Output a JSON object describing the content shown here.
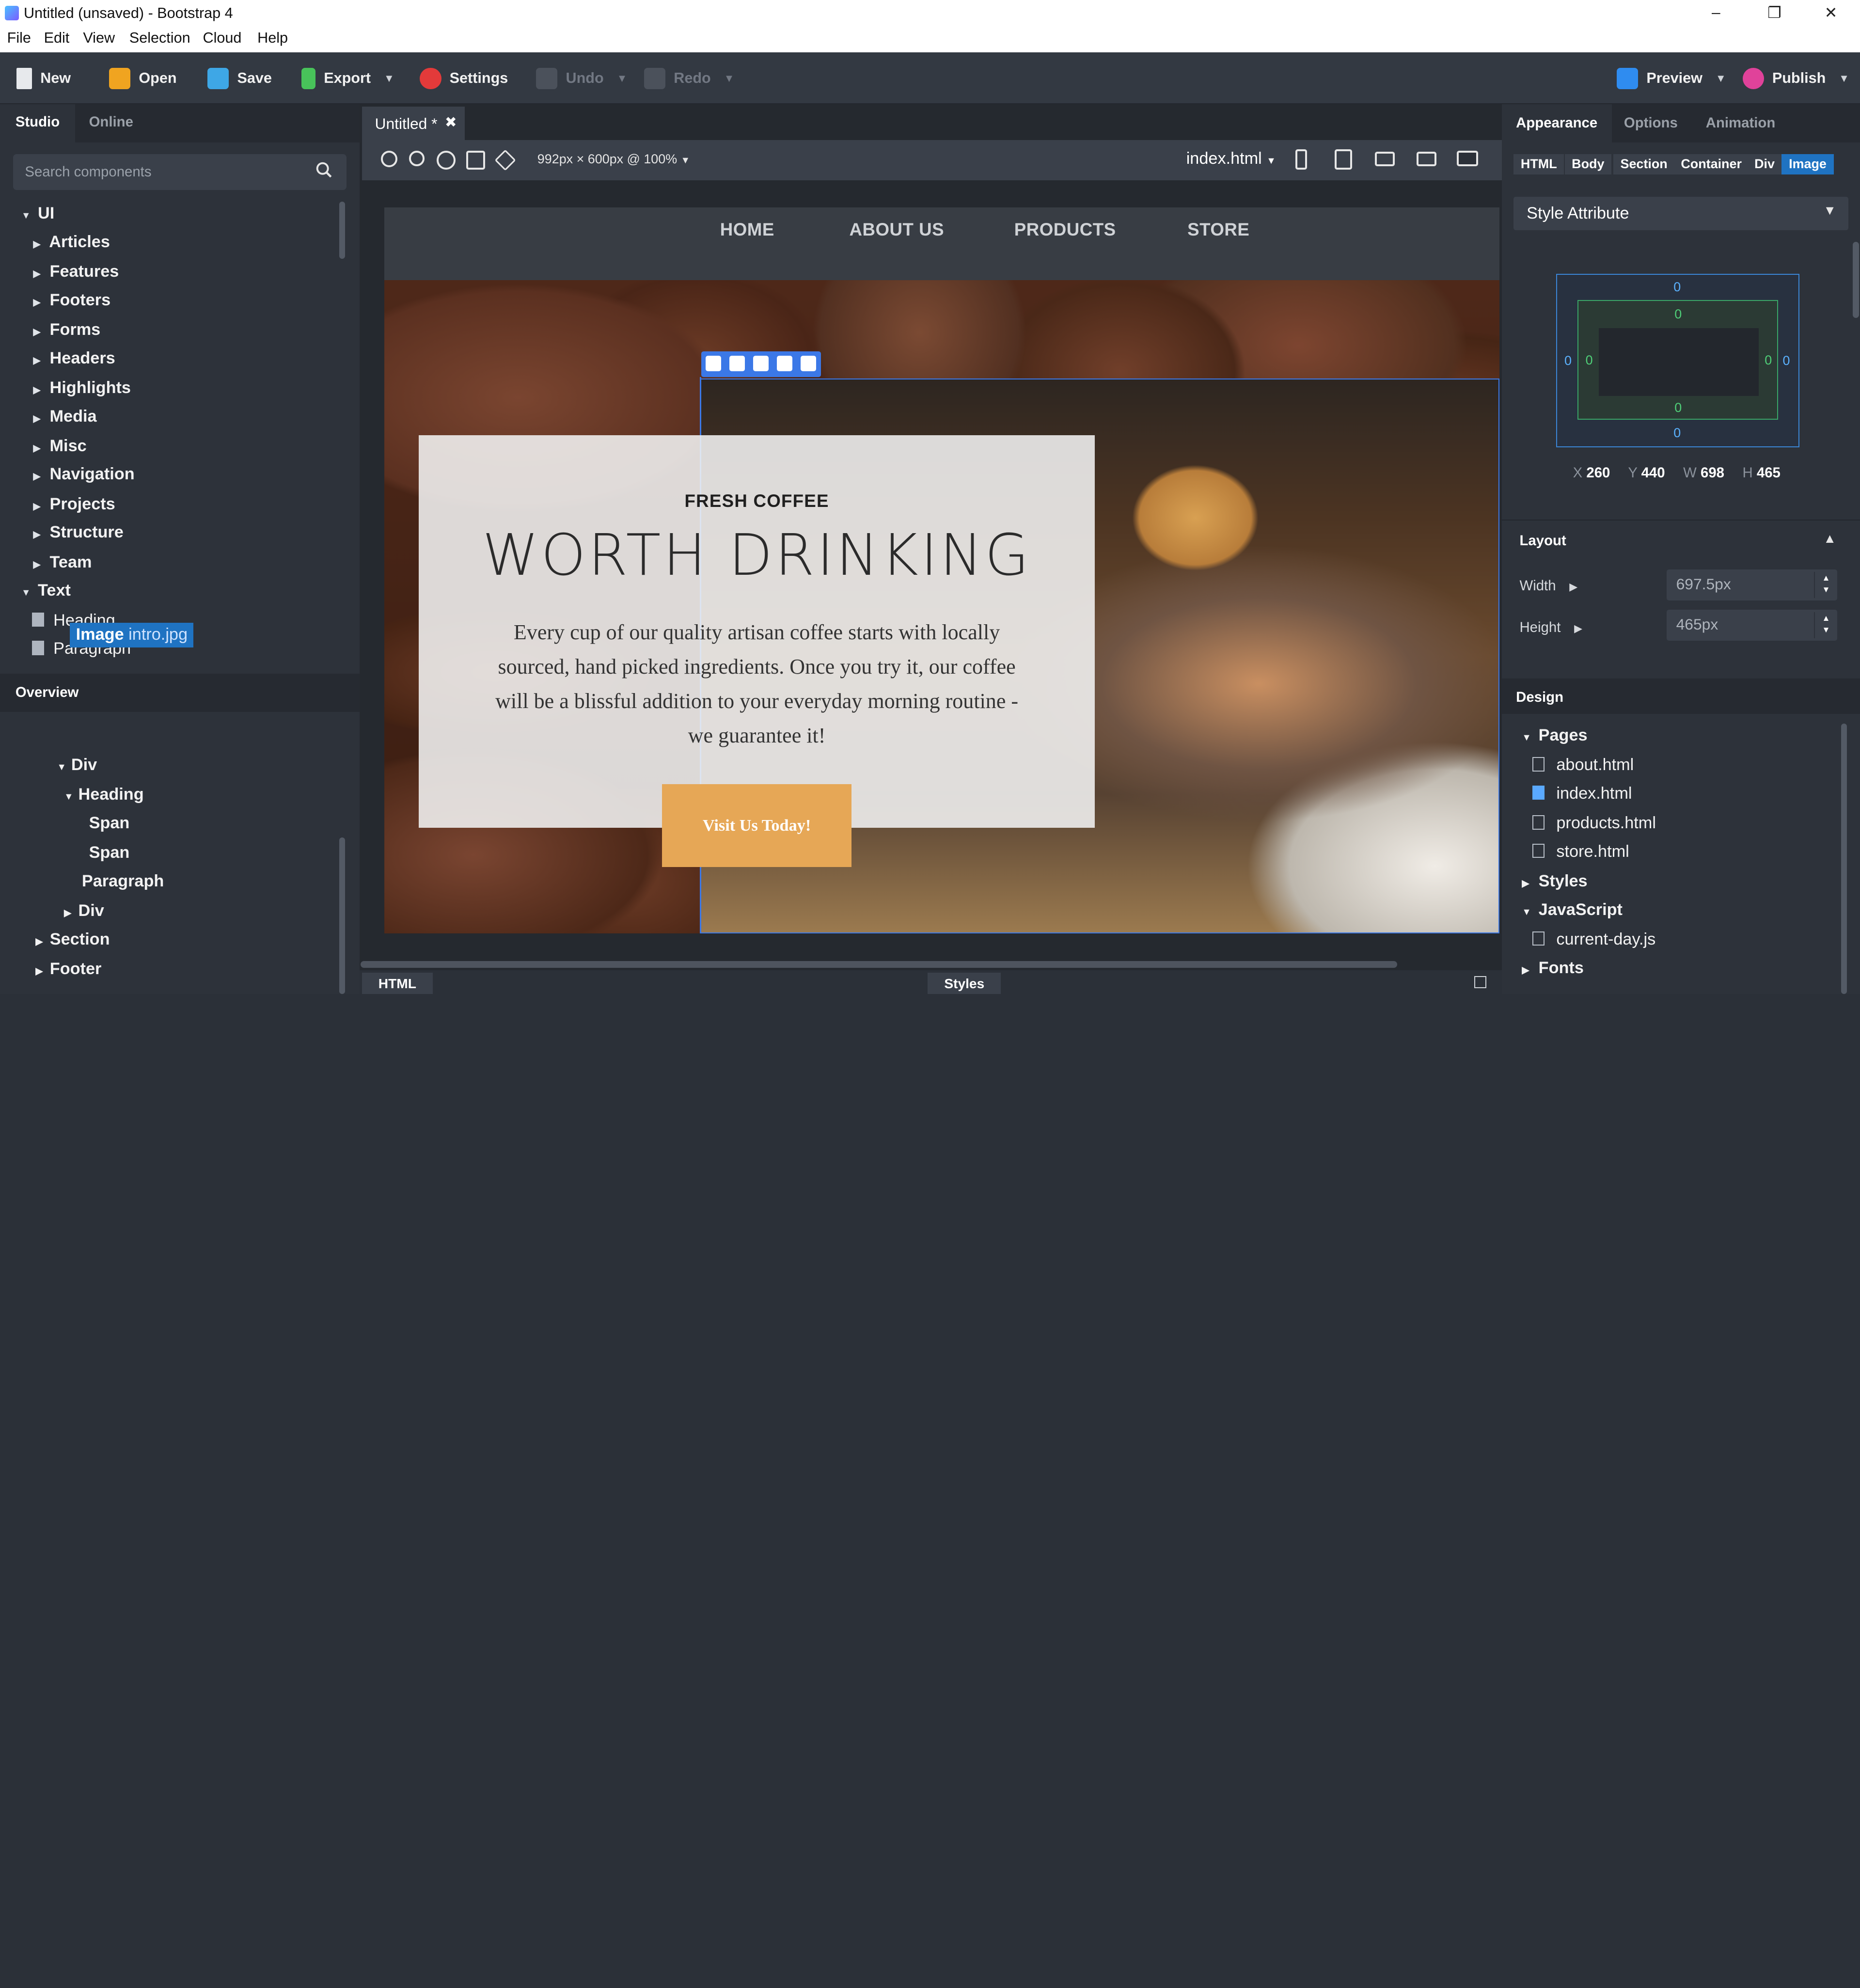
{
  "window": {
    "title": "Untitled (unsaved) - Bootstrap 4",
    "controls": [
      "minimize",
      "restore",
      "close"
    ]
  },
  "menu": [
    "File",
    "Edit",
    "View",
    "Selection",
    "Cloud",
    "Help"
  ],
  "toolbar": {
    "new": "New",
    "open": "Open",
    "save": "Save",
    "export": "Export",
    "settings": "Settings",
    "undo": "Undo",
    "redo": "Redo",
    "preview": "Preview",
    "publish": "Publish"
  },
  "left": {
    "tabs": [
      "Studio",
      "Online"
    ],
    "search_placeholder": "Search components",
    "tree": [
      {
        "label": "UI",
        "expanded": true
      },
      {
        "label": "Articles"
      },
      {
        "label": "Features"
      },
      {
        "label": "Footers"
      },
      {
        "label": "Forms"
      },
      {
        "label": "Headers"
      },
      {
        "label": "Highlights"
      },
      {
        "label": "Media"
      },
      {
        "label": "Misc"
      },
      {
        "label": "Navigation"
      },
      {
        "label": "Projects"
      },
      {
        "label": "Structure"
      },
      {
        "label": "Team"
      },
      {
        "label": "Text",
        "expanded": true
      },
      {
        "label": "Heading"
      },
      {
        "label": "Paragraph"
      }
    ],
    "overview_title": "Overview",
    "overview": {
      "selected": "Image",
      "selected_detail": "intro.jpg",
      "items": [
        "Div",
        "Heading",
        "Span",
        "Span",
        "Paragraph",
        "Div",
        "Section",
        "Footer"
      ]
    }
  },
  "editor": {
    "doc_tab": "Untitled *",
    "dims": "992px × 600px @ 100%",
    "page": "index.html",
    "site": {
      "nav": [
        "HOME",
        "ABOUT US",
        "PRODUCTS",
        "STORE"
      ],
      "eyebrow": "FRESH COFFEE",
      "headline": "WORTH DRINKING",
      "paragraph": "Every cup of our quality artisan coffee starts with locally sourced, hand picked ingredients. Once you try it, our coffee will be a blissful addition to your everyday morning routine - we guarantee it!",
      "cta": "Visit Us Today!"
    },
    "bottom_tabs": [
      "HTML",
      "Styles"
    ]
  },
  "right": {
    "tabs": [
      "Appearance",
      "Options",
      "Animation"
    ],
    "breadcrumbs": [
      "HTML",
      "Body",
      "Section",
      "Container",
      "Div",
      "Image"
    ],
    "style_select": "Style Attribute",
    "box_values": {
      "margin_top": "0",
      "padding_top": "0",
      "margin_left": "0",
      "padding_left": "0",
      "padding_right": "0",
      "margin_right": "0",
      "padding_bottom": "0",
      "margin_bottom": "0"
    },
    "metrics": {
      "x": "260",
      "y": "440",
      "w": "698",
      "h": "465"
    },
    "layout_title": "Layout",
    "width_label": "Width",
    "width_value": "697.5px",
    "height_label": "Height",
    "height_value": "465px",
    "design_title": "Design",
    "design": {
      "pages_label": "Pages",
      "pages": [
        "about.html",
        "index.html",
        "products.html",
        "store.html"
      ],
      "styles_label": "Styles",
      "js_label": "JavaScript",
      "js_files": [
        "current-day.js"
      ],
      "fonts_label": "Fonts"
    }
  }
}
